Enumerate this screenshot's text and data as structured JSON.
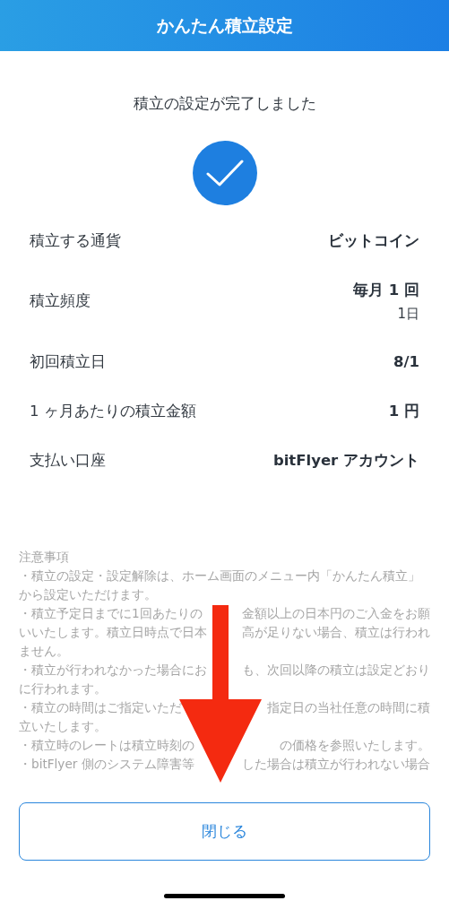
{
  "header": {
    "title": "かんたん積立設定"
  },
  "message": "積立の設定が完了しました",
  "details": [
    {
      "label": "積立する通貨",
      "value": "ビットコイン"
    },
    {
      "label": "積立頻度",
      "value": "毎月 1 回",
      "sub": "1日"
    },
    {
      "label": "初回積立日",
      "value": "8/1"
    },
    {
      "label": "1 ヶ月あたりの積立金額",
      "value": "1 円"
    },
    {
      "label": "支払い口座",
      "value": "bitFlyer アカウント"
    }
  ],
  "notes": {
    "title": "注意事項",
    "lines": [
      [
        "・積立の設定・設定解除は、ホーム画面のメニュー内「かんたん積立」"
      ],
      [
        "から設定いただけます。"
      ],
      [
        "・積立予定日までに1回あたりの",
        "金額以上の日本円のご入金をお願"
      ],
      [
        "いいたします。積立日時点で日本",
        "高が足りない場合、積立は行われ"
      ],
      [
        "ません。"
      ],
      [
        "・積立が行われなかった場合にお",
        "も、次回以降の積立は設定どおり"
      ],
      [
        "に行われます。"
      ],
      [
        "・積立の時間はご指定いただ",
        "指定日の当社任意の時間に積"
      ],
      [
        "立いたします。"
      ],
      [
        "・積立時のレートは積立時刻の",
        "の価格を参照いたします。"
      ],
      [
        "・bitFlyer 側のシステム障害等",
        "した場合は積立が行われない場合"
      ]
    ]
  },
  "close_button": "閉じる"
}
